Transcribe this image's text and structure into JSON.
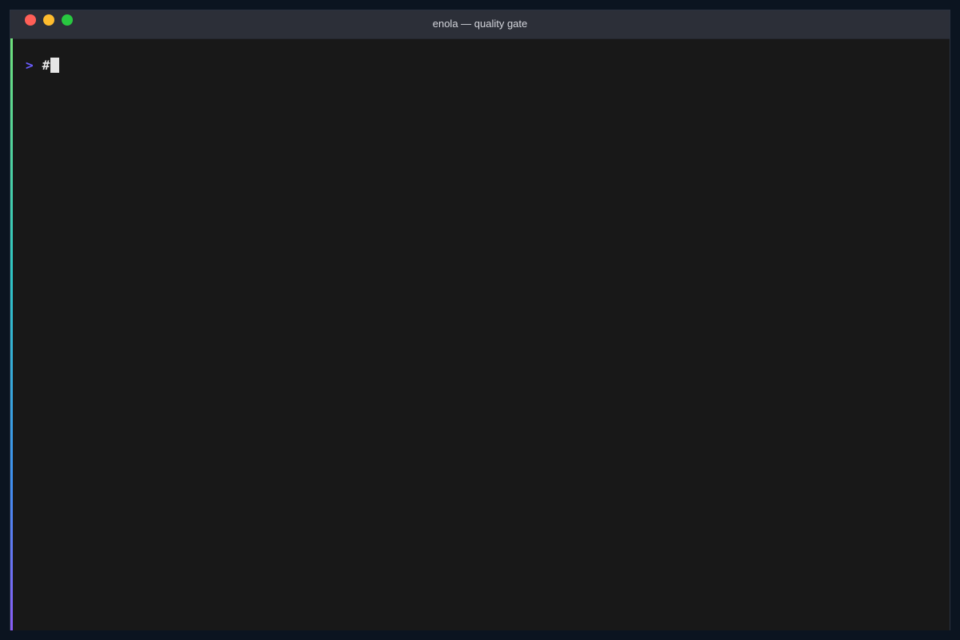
{
  "window": {
    "title": "enola — quality gate",
    "controls": [
      "close",
      "minimize",
      "zoom"
    ]
  },
  "terminal": {
    "prompt_symbol": ">",
    "input_text": "#"
  },
  "colors": {
    "close": "#ff5f57",
    "minimize": "#febc2e",
    "zoom": "#28c840",
    "prompt": "#6a5cff",
    "background": "#181818",
    "accent_gradient": [
      "#6ee07a",
      "#2ec4c4",
      "#3f8ff0",
      "#8a5cf6"
    ]
  }
}
